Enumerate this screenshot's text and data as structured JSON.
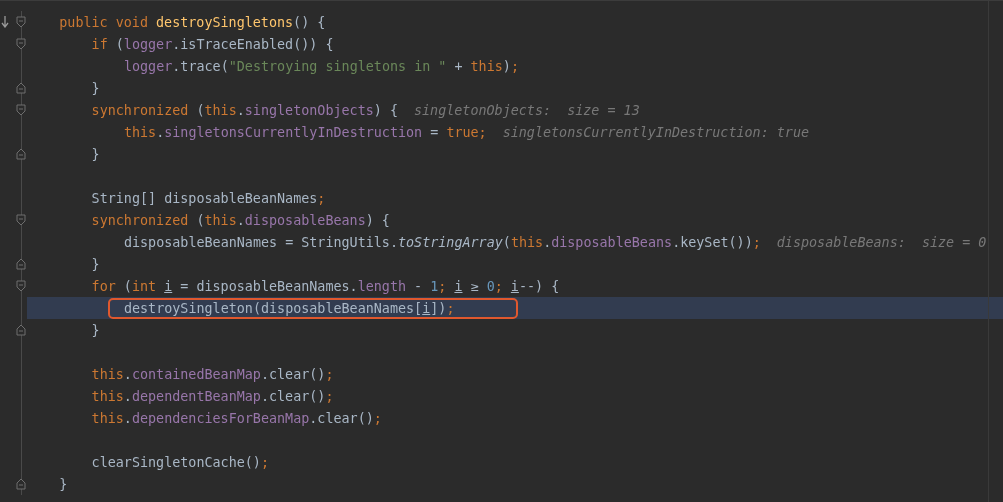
{
  "editor": {
    "lines": [
      {
        "kind": "open",
        "current": false,
        "gutter_icon": true,
        "tokens": [
          {
            "kind": "keyword",
            "text": "public void "
          },
          {
            "kind": "declaration",
            "text": "destroySingletons"
          },
          {
            "kind": "plain",
            "text": "() {"
          }
        ],
        "children": [
          {
            "kind": "open",
            "current": false,
            "tokens": [
              {
                "kind": "keyword",
                "text": "if "
              },
              {
                "kind": "plain",
                "text": "("
              },
              {
                "kind": "field",
                "text": "logger"
              },
              {
                "kind": "plain",
                "text": ".isTraceEnabled()) {"
              }
            ],
            "children": [
              {
                "kind": "code",
                "current": false,
                "tokens": [
                  {
                    "kind": "field",
                    "text": "logger"
                  },
                  {
                    "kind": "plain",
                    "text": ".trace("
                  },
                  {
                    "kind": "string",
                    "text": "\"Destroying singletons in \""
                  },
                  {
                    "kind": "plain",
                    "text": " + "
                  },
                  {
                    "kind": "keyword",
                    "text": "this"
                  },
                  {
                    "kind": "plain",
                    "text": ")"
                  },
                  {
                    "kind": "keyword",
                    "text": ";"
                  }
                ]
              }
            ]
          },
          {
            "kind": "close",
            "current": false,
            "tokens": [
              {
                "kind": "plain",
                "text": "}"
              }
            ]
          },
          {
            "kind": "open",
            "current": false,
            "tokens": [
              {
                "kind": "keyword",
                "text": "synchronized "
              },
              {
                "kind": "plain",
                "text": "("
              },
              {
                "kind": "keyword",
                "text": "this"
              },
              {
                "kind": "plain",
                "text": "."
              },
              {
                "kind": "field",
                "text": "singletonObjects"
              },
              {
                "kind": "plain",
                "text": ") {"
              },
              {
                "kind": "hint",
                "text": "singletonObjects:  size = 13"
              }
            ],
            "children": [
              {
                "kind": "code",
                "current": false,
                "tokens": [
                  {
                    "kind": "keyword",
                    "text": "this"
                  },
                  {
                    "kind": "plain",
                    "text": "."
                  },
                  {
                    "kind": "field",
                    "text": "singletonsCurrentlyInDestruction"
                  },
                  {
                    "kind": "plain",
                    "text": " = "
                  },
                  {
                    "kind": "keyword",
                    "text": "true;"
                  },
                  {
                    "kind": "hint",
                    "text": "singletonsCurrentlyInDestruction: true"
                  }
                ]
              }
            ]
          },
          {
            "kind": "close",
            "current": false,
            "tokens": [
              {
                "kind": "plain",
                "text": "}"
              }
            ]
          },
          {
            "kind": "blank",
            "current": false
          },
          {
            "kind": "code",
            "current": false,
            "tokens": [
              {
                "kind": "plain",
                "text": "String[] disposableBeanNames"
              },
              {
                "kind": "keyword",
                "text": ";"
              }
            ]
          },
          {
            "kind": "open",
            "current": false,
            "tokens": [
              {
                "kind": "keyword",
                "text": "synchronized "
              },
              {
                "kind": "plain",
                "text": "("
              },
              {
                "kind": "keyword",
                "text": "this"
              },
              {
                "kind": "plain",
                "text": "."
              },
              {
                "kind": "field",
                "text": "disposableBeans"
              },
              {
                "kind": "plain",
                "text": ") {"
              }
            ],
            "children": [
              {
                "kind": "code",
                "current": false,
                "tokens": [
                  {
                    "kind": "plain",
                    "text": "disposableBeanNames = StringUtils."
                  },
                  {
                    "kind": "static",
                    "text": "toStringArray"
                  },
                  {
                    "kind": "plain",
                    "text": "("
                  },
                  {
                    "kind": "keyword",
                    "text": "this"
                  },
                  {
                    "kind": "plain",
                    "text": "."
                  },
                  {
                    "kind": "field",
                    "text": "disposableBeans"
                  },
                  {
                    "kind": "plain",
                    "text": ".keySet())"
                  },
                  {
                    "kind": "keyword",
                    "text": ";"
                  },
                  {
                    "kind": "hint",
                    "text": "disposableBeans:  size = 0"
                  }
                ]
              }
            ]
          },
          {
            "kind": "close",
            "current": false,
            "tokens": [
              {
                "kind": "plain",
                "text": "}"
              }
            ]
          },
          {
            "kind": "open",
            "current": false,
            "tokens": [
              {
                "kind": "keyword",
                "text": "for "
              },
              {
                "kind": "plain",
                "text": "("
              },
              {
                "kind": "keyword",
                "text": "int "
              },
              {
                "kind": "underlined",
                "text": "i"
              },
              {
                "kind": "plain",
                "text": " = disposableBeanNames."
              },
              {
                "kind": "field",
                "text": "length"
              },
              {
                "kind": "plain",
                "text": " - "
              },
              {
                "kind": "number",
                "text": "1"
              },
              {
                "kind": "keyword",
                "text": "; "
              },
              {
                "kind": "underlined",
                "text": "i"
              },
              {
                "kind": "plain",
                "text": " ≥ "
              },
              {
                "kind": "number",
                "text": "0"
              },
              {
                "kind": "keyword",
                "text": "; "
              },
              {
                "kind": "underlined",
                "text": "i"
              },
              {
                "kind": "plain",
                "text": "--) {"
              }
            ],
            "children": [
              {
                "kind": "code",
                "current": true,
                "boxed": true,
                "tokens": [
                  {
                    "kind": "plain",
                    "text": "destroySingleton(disposableBeanNames["
                  },
                  {
                    "kind": "underlined",
                    "text": "i"
                  },
                  {
                    "kind": "plain",
                    "text": "])"
                  },
                  {
                    "kind": "keyword",
                    "text": ";"
                  }
                ]
              }
            ]
          },
          {
            "kind": "close",
            "current": false,
            "tokens": [
              {
                "kind": "plain",
                "text": "}"
              }
            ]
          },
          {
            "kind": "blank",
            "current": false
          },
          {
            "kind": "code",
            "current": false,
            "tokens": [
              {
                "kind": "keyword",
                "text": "this"
              },
              {
                "kind": "plain",
                "text": "."
              },
              {
                "kind": "field",
                "text": "containedBeanMap"
              },
              {
                "kind": "plain",
                "text": ".clear()"
              },
              {
                "kind": "keyword",
                "text": ";"
              }
            ]
          },
          {
            "kind": "code",
            "current": false,
            "tokens": [
              {
                "kind": "keyword",
                "text": "this"
              },
              {
                "kind": "plain",
                "text": "."
              },
              {
                "kind": "field",
                "text": "dependentBeanMap"
              },
              {
                "kind": "plain",
                "text": ".clear()"
              },
              {
                "kind": "keyword",
                "text": ";"
              }
            ]
          },
          {
            "kind": "code",
            "current": false,
            "tokens": [
              {
                "kind": "keyword",
                "text": "this"
              },
              {
                "kind": "plain",
                "text": "."
              },
              {
                "kind": "field",
                "text": "dependenciesForBeanMap"
              },
              {
                "kind": "plain",
                "text": ".clear()"
              },
              {
                "kind": "keyword",
                "text": ";"
              }
            ]
          },
          {
            "kind": "blank",
            "current": false
          },
          {
            "kind": "code",
            "current": false,
            "tokens": [
              {
                "kind": "plain",
                "text": "clearSingletonCache()"
              },
              {
                "kind": "keyword",
                "text": ";"
              }
            ]
          }
        ]
      },
      {
        "kind": "close",
        "current": false,
        "tokens": [
          {
            "kind": "plain",
            "text": "}"
          }
        ]
      }
    ]
  }
}
